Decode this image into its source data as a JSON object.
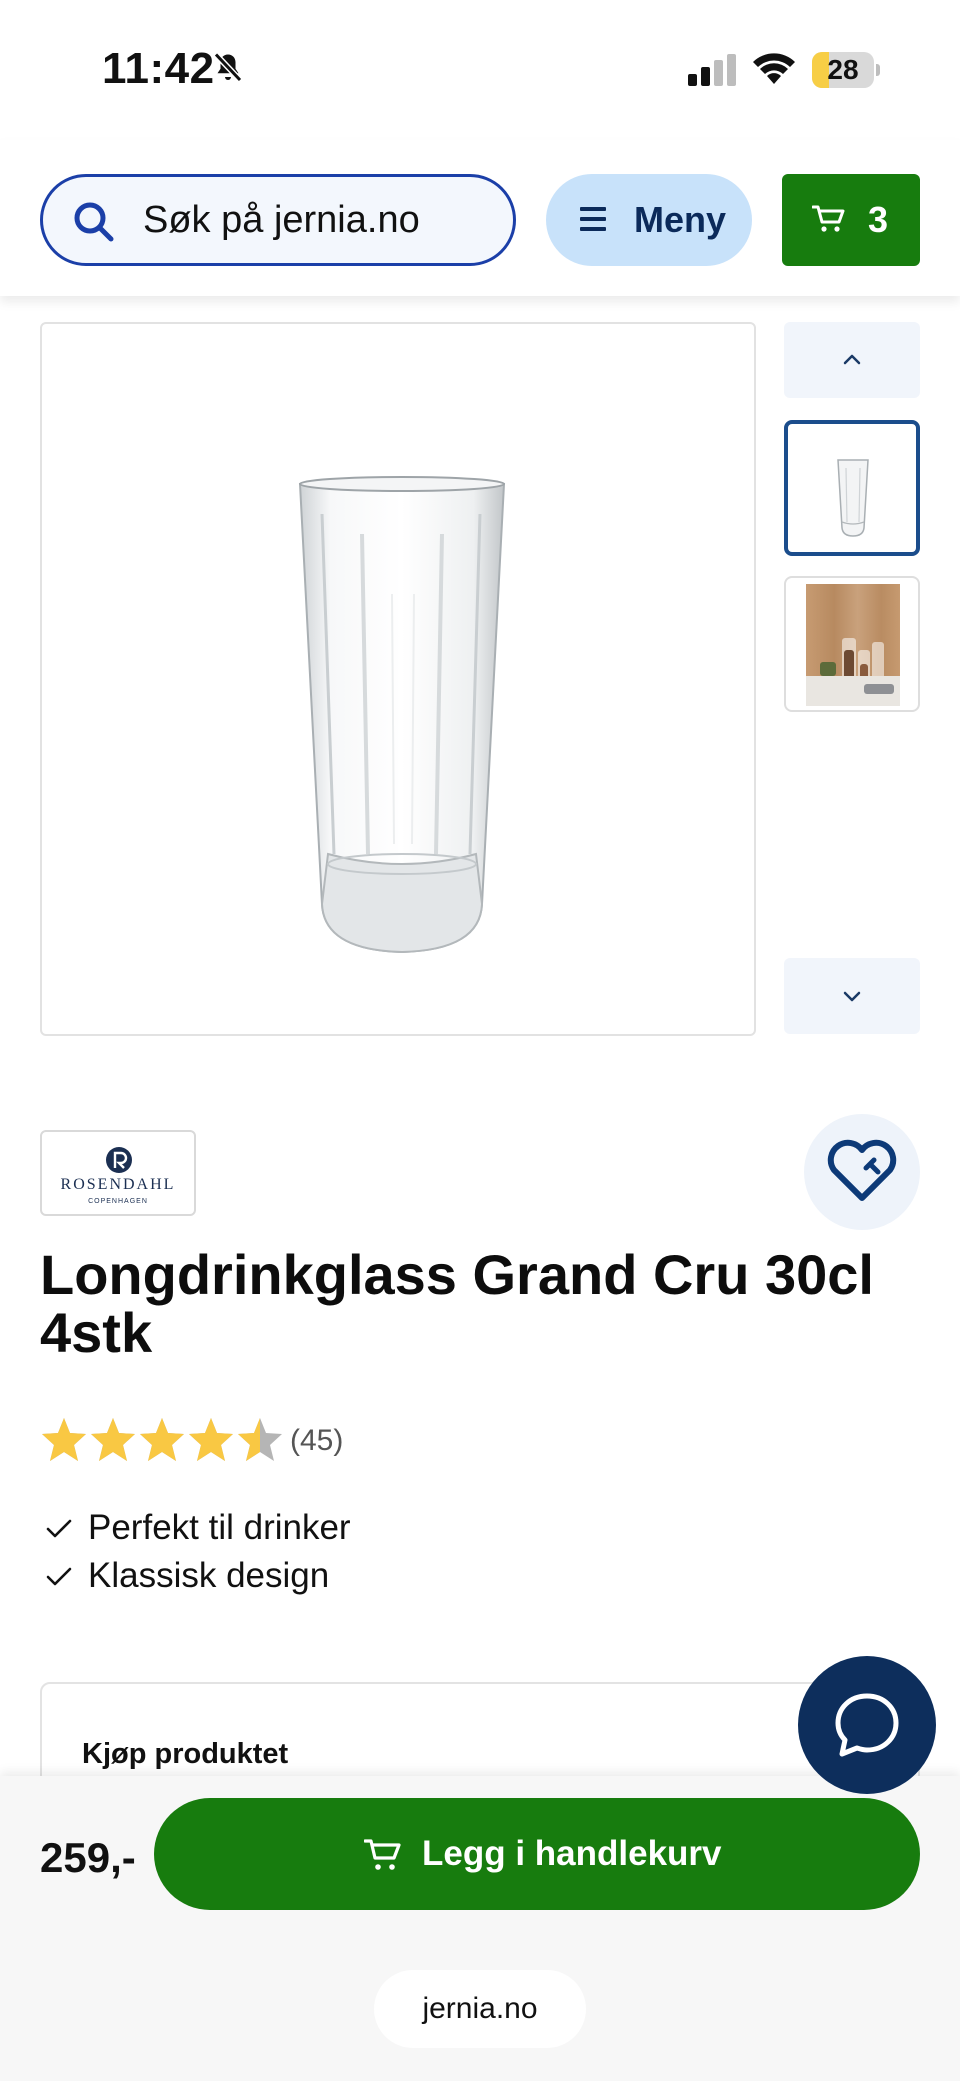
{
  "status_bar": {
    "time": "11:42",
    "battery_level": "28",
    "battery_fraction": 0.28,
    "icons": [
      "bell-slash-icon",
      "cellular-signal-icon",
      "wifi-icon",
      "battery-icon"
    ]
  },
  "header": {
    "search_placeholder": "Søk på jernia.no",
    "menu_label": "Meny",
    "cart_count": "3",
    "colors": {
      "search_border": "#1b3fa8",
      "menu_bg": "#c8e2fa",
      "cart_bg": "#177c0e"
    }
  },
  "gallery": {
    "main_image": "longdrink-glass",
    "thumbnails": [
      "glass-thumbnail",
      "lifestyle-photo-thumbnail"
    ],
    "selected_index": 0
  },
  "product": {
    "brand": "ROSENDAHL",
    "brand_sub": "COPENHAGEN",
    "title": "Longdrinkglass Grand Cru 30cl 4stk",
    "rating_value": 4.5,
    "rating_count": "(45)",
    "features": [
      "Perfekt til drinker",
      "Klassisk design"
    ]
  },
  "buy_panel": {
    "title": "Kjøp produktet"
  },
  "bottom_bar": {
    "price": "259,-",
    "add_to_cart_label": "Legg i handlekurv",
    "url": "jernia.no"
  },
  "colors": {
    "primary_green": "#177c0e",
    "navy": "#0d2e5c",
    "star": "#f9c843",
    "star_empty": "#b5b5b5"
  }
}
